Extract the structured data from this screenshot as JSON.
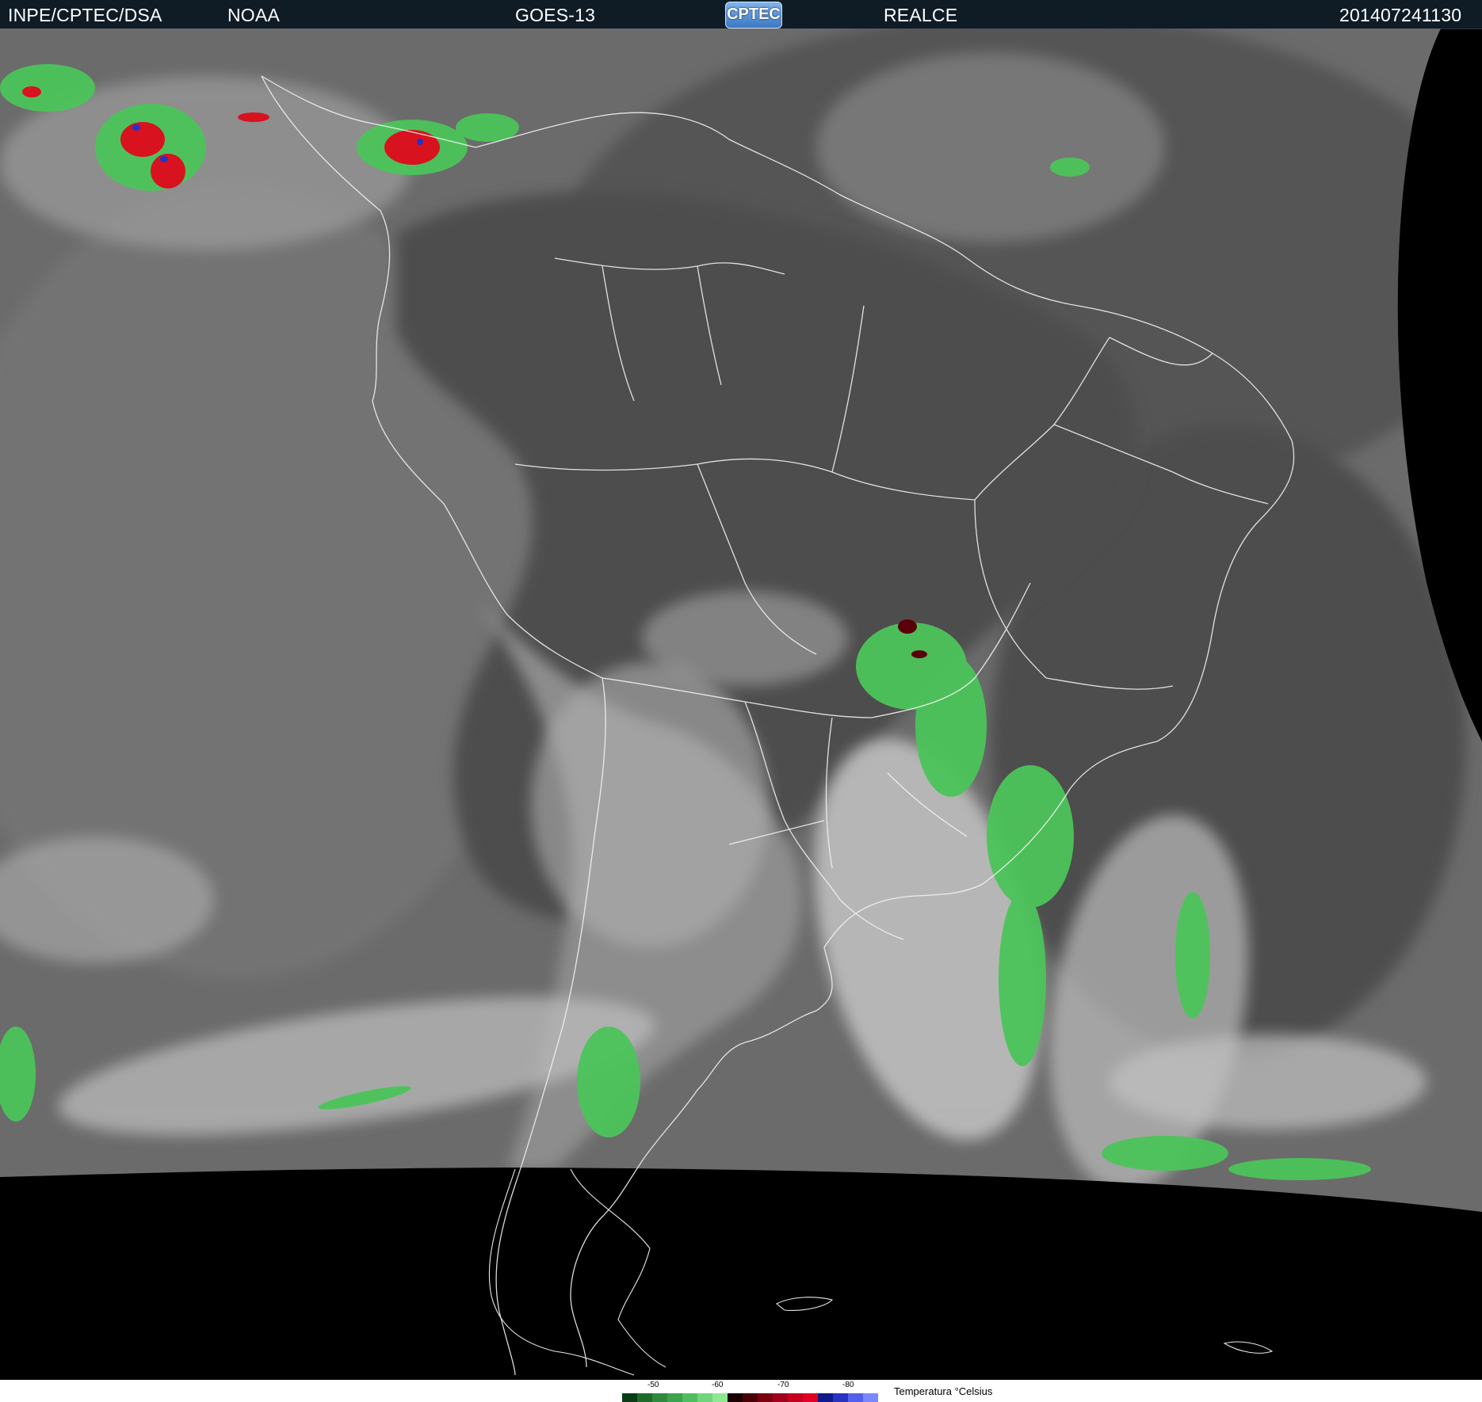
{
  "header": {
    "source": "INPE/CPTEC/DSA",
    "agency": "NOAA",
    "satellite": "GOES-13",
    "logo_text": "CPTEC",
    "product": "REALCE",
    "timestamp": "201407241130"
  },
  "legend": {
    "title": "Temperatura  °Celsius",
    "ticks": [
      "-50",
      "-60",
      "-70",
      "-80"
    ],
    "colors": [
      "#0a3d14",
      "#1f6b2c",
      "#2f8a3c",
      "#3ea24c",
      "#52bd5e",
      "#6fd57a",
      "#8ee88f",
      "#1a0000",
      "#4a0008",
      "#7a0010",
      "#a0001a",
      "#c4001e",
      "#e00022",
      "#101a8a",
      "#2a32c0",
      "#5560e8",
      "#7a88ff"
    ]
  }
}
